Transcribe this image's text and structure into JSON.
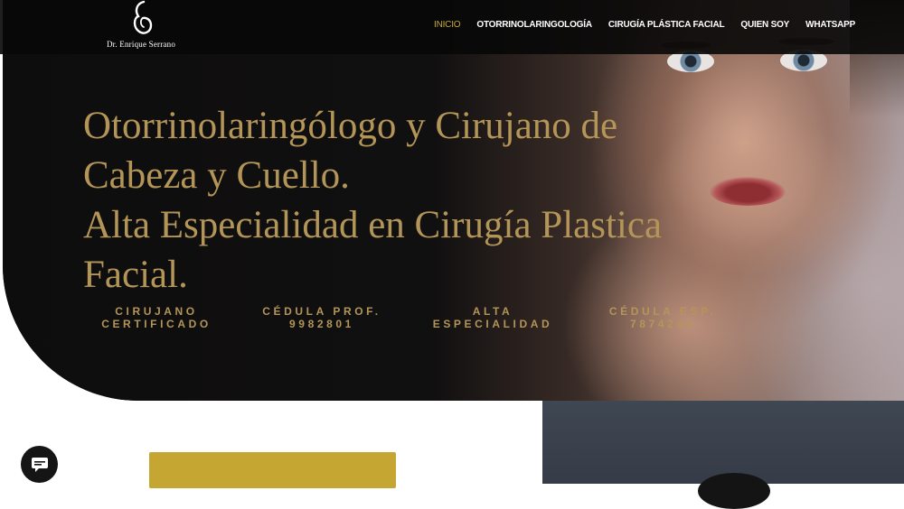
{
  "header": {
    "logo_text": "Dr. Enrique Serrano",
    "nav": [
      {
        "label": "INICIO",
        "active": true
      },
      {
        "label": "OTORRINOLARINGOLOGÍA",
        "active": false
      },
      {
        "label": "CIRUGÍA PLÁSTICA FACIAL",
        "active": false
      },
      {
        "label": "QUIEN SOY",
        "active": false
      },
      {
        "label": "WHATSAPP",
        "active": false
      }
    ]
  },
  "hero": {
    "headline_lines": [
      "Otorrinolaringólogo y Cirujano de",
      "Cabeza y Cuello.",
      "Alta Especialidad en Cirugía Plastica",
      "Facial."
    ],
    "credentials": [
      {
        "line1": "CIRUJANO",
        "line2": "CERTIFICADO"
      },
      {
        "line1": "CÉDULA PROF.",
        "line2": "9982801"
      },
      {
        "line1": "ALTA",
        "line2": "ESPECIALIDAD"
      },
      {
        "line1": "CÉDULA ESP.",
        "line2": "7874246"
      }
    ]
  },
  "colors": {
    "gold_text": "#b49558",
    "nav_active": "#c7a73a",
    "button_gold": "#c6a633",
    "header_bg": "#080808"
  },
  "icons": {
    "logo": "profile-face-logo-icon",
    "chat": "chat-bubble-icon"
  }
}
